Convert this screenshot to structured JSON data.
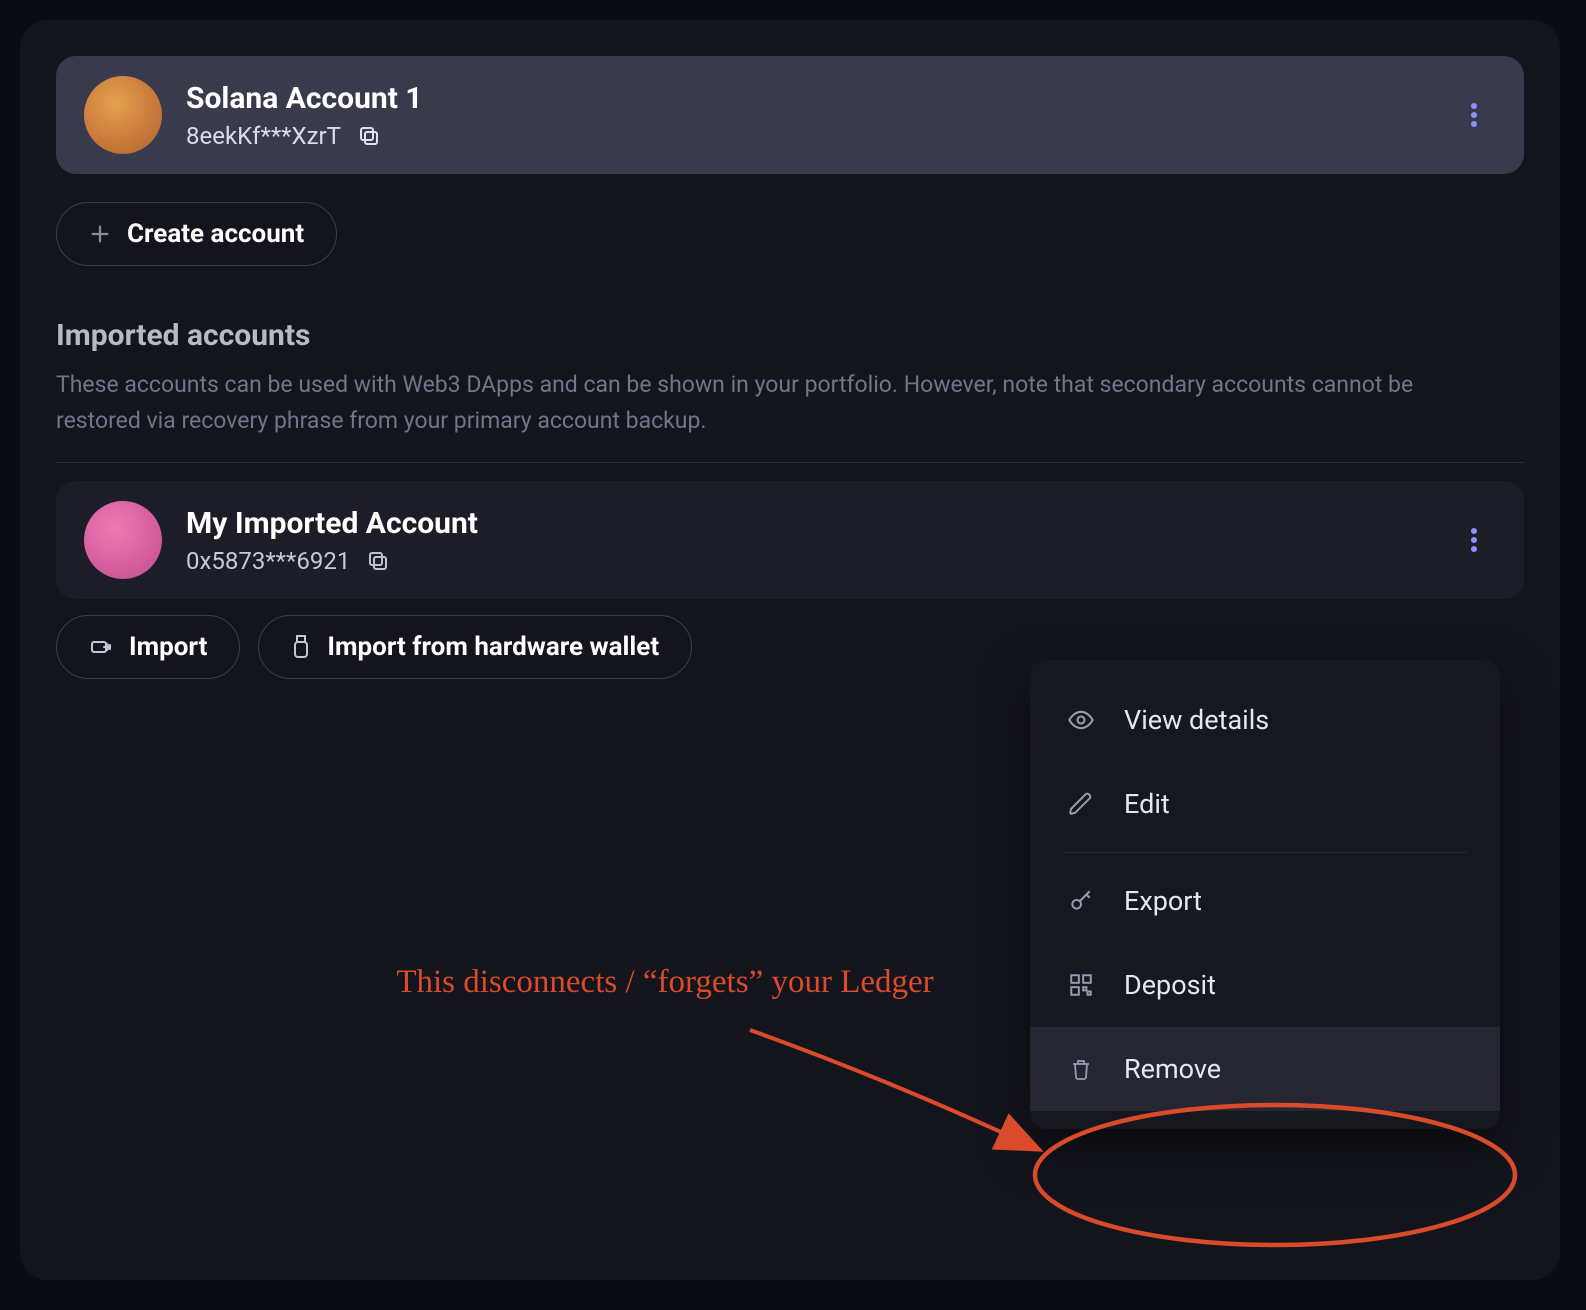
{
  "primary_account": {
    "name": "Solana Account 1",
    "address": "8eekKf***XzrT"
  },
  "create_account_label": "Create account",
  "imported_section": {
    "title": "Imported accounts",
    "description": "These accounts can be used with Web3 DApps and can be shown in your portfolio. However, note that secondary accounts cannot be restored via recovery phrase from your primary account backup."
  },
  "imported_account": {
    "name": "My Imported Account",
    "address": "0x5873***6921"
  },
  "import_label": "Import",
  "import_hw_label": "Import from hardware wallet",
  "menu": {
    "view_details": "View details",
    "edit": "Edit",
    "export": "Export",
    "deposit": "Deposit",
    "remove": "Remove"
  },
  "annotation": "This disconnects / “forgets” your Ledger",
  "colors": {
    "annotation": "#d94b2b",
    "accent_dots": "#8f8fff"
  }
}
